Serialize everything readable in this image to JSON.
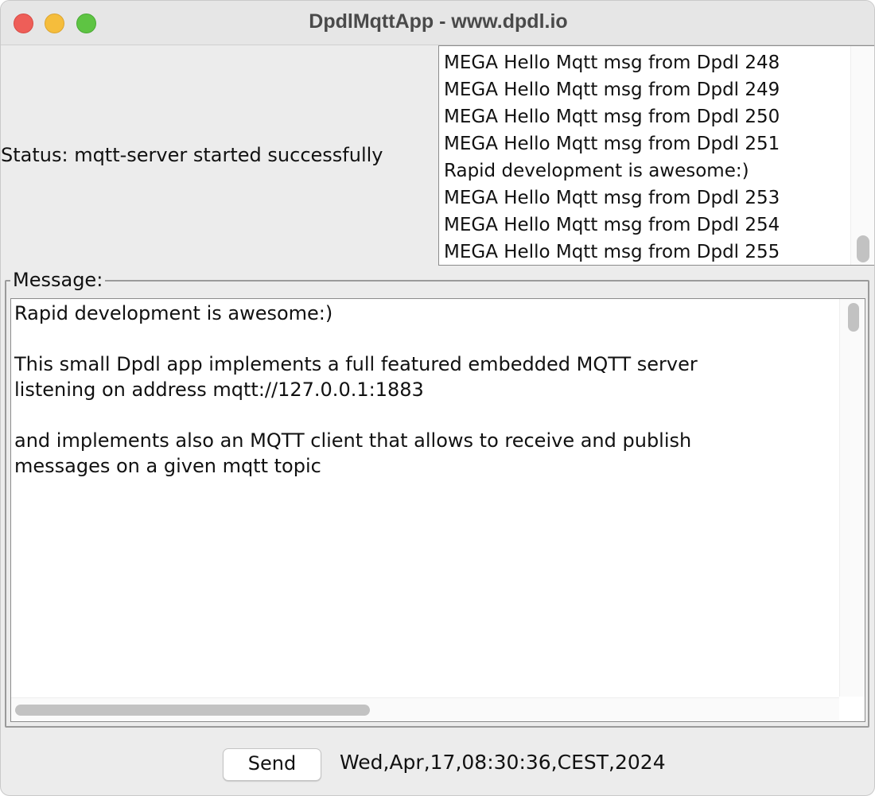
{
  "window": {
    "title": "DpdlMqttApp - www.dpdl.io"
  },
  "status": {
    "text": "Status: mqtt-server started successfully"
  },
  "log": {
    "lines": [
      "MEGA Hello Mqtt msg from Dpdl 248",
      "MEGA Hello Mqtt msg from Dpdl 249",
      "MEGA Hello Mqtt msg from Dpdl 250",
      "MEGA Hello Mqtt msg from Dpdl 251",
      "Rapid development is awesome:)",
      "MEGA Hello Mqtt msg from Dpdl 253",
      "MEGA Hello Mqtt msg from Dpdl 254",
      "MEGA Hello Mqtt msg from Dpdl 255"
    ]
  },
  "message": {
    "label": "Message:",
    "lines": [
      "Rapid development is awesome:)",
      "",
      "This small Dpdl app implements a full featured embedded MQTT server",
      "listening on address mqtt://127.0.0.1:1883",
      "",
      "and implements also an MQTT client that allows to receive and publish",
      "messages on a given mqtt topic"
    ]
  },
  "footer": {
    "send_label": "Send",
    "datetime": "Wed,Apr,17,08:30:36,CEST,2024"
  },
  "colors": {
    "close": "#ee5e58",
    "minimize": "#f5bd3c",
    "maximize": "#5ec443"
  },
  "icons": [
    "close-traffic-light-icon",
    "minimize-traffic-light-icon",
    "maximize-traffic-light-icon"
  ]
}
